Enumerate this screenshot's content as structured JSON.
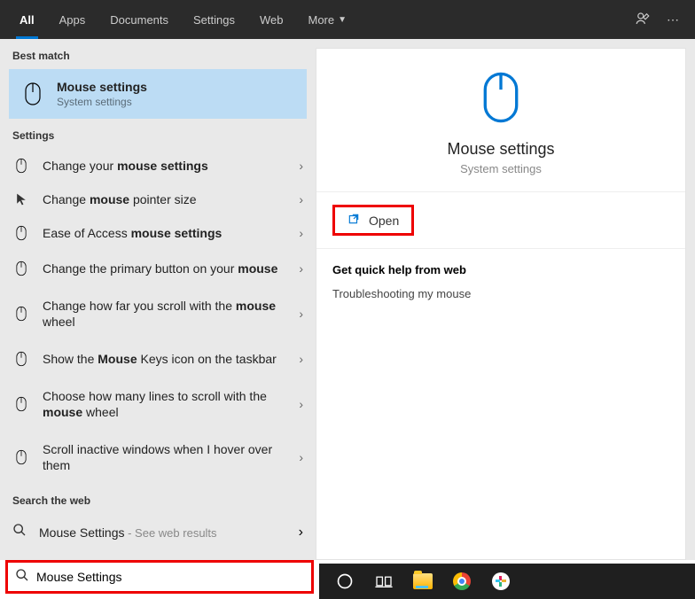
{
  "tabs": {
    "all": "All",
    "apps": "Apps",
    "documents": "Documents",
    "settings": "Settings",
    "web": "Web",
    "more": "More"
  },
  "sections": {
    "bestMatch": "Best match",
    "settings": "Settings",
    "searchWeb": "Search the web"
  },
  "best": {
    "title": "Mouse settings",
    "subtitle": "System settings"
  },
  "items": {
    "i0_pre": "Change your ",
    "i0_b": "mouse settings",
    "i1_pre": "Change ",
    "i1_b": "mouse",
    "i1_post": " pointer size",
    "i2_pre": "Ease of Access ",
    "i2_b": "mouse settings",
    "i3_pre": "Change the primary button on your ",
    "i3_b": "mouse",
    "i4_pre": "Change how far you scroll with the ",
    "i4_b": "mouse",
    "i4_post": " wheel",
    "i5_pre": "Show the ",
    "i5_b": "Mouse",
    "i5_post": " Keys icon on the taskbar",
    "i6_pre": "Choose how many lines to scroll with the ",
    "i6_b": "mouse",
    "i6_post": " wheel",
    "i7": "Scroll inactive windows when I hover over them"
  },
  "web": {
    "title": "Mouse Settings",
    "sub": " - See web results"
  },
  "detail": {
    "title": "Mouse settings",
    "subtitle": "System settings",
    "open": "Open"
  },
  "help": {
    "header": "Get quick help from web",
    "link1": "Troubleshooting my mouse"
  },
  "search": {
    "value": "Mouse Settings"
  }
}
